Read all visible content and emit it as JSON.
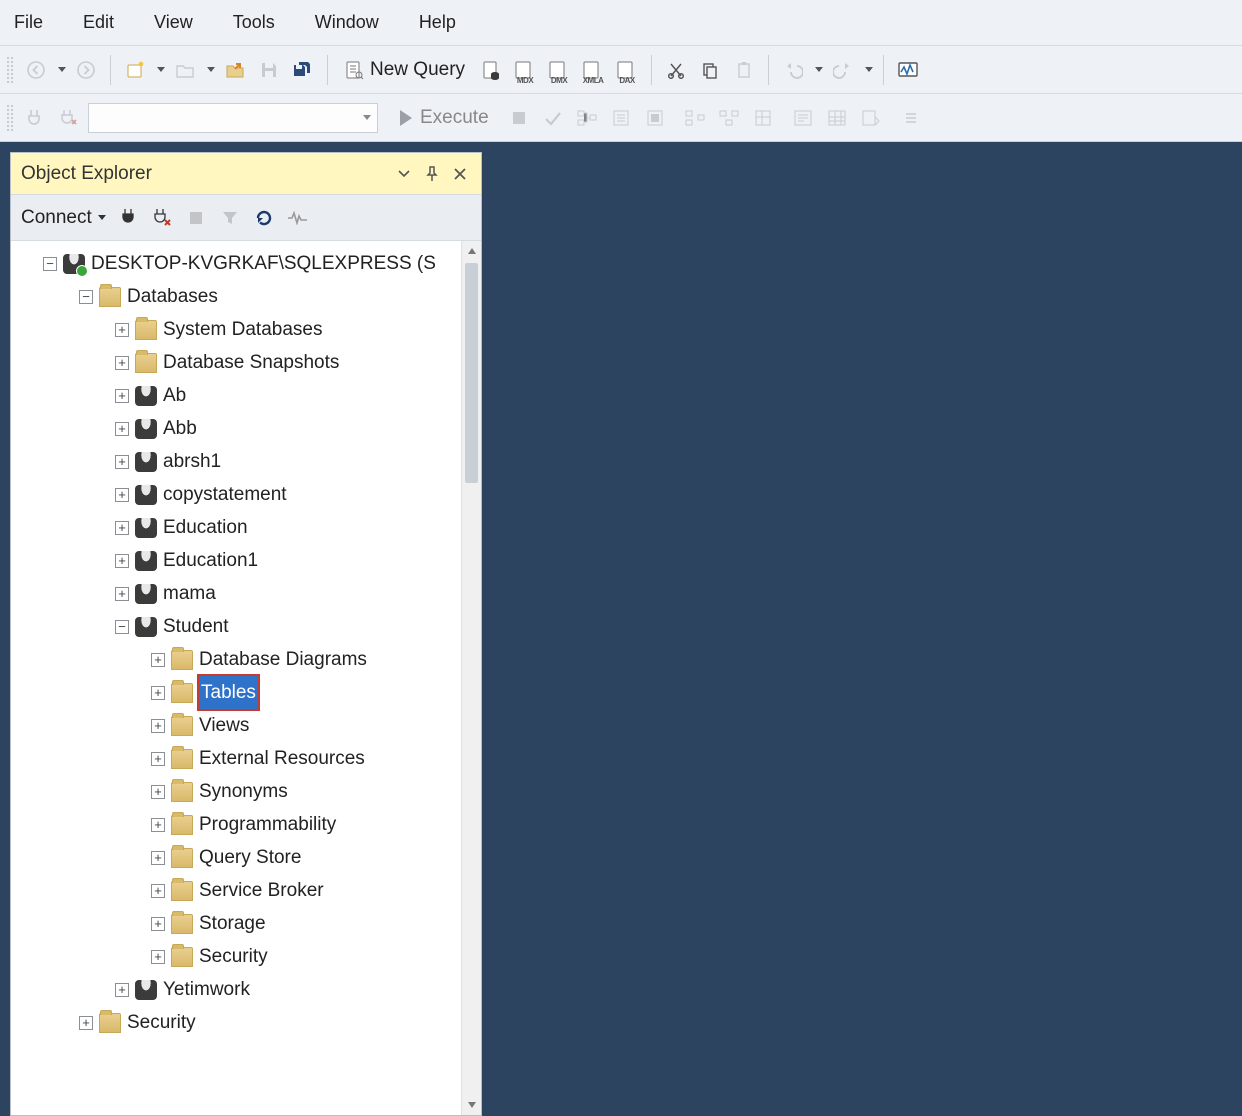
{
  "menu": {
    "file": "File",
    "edit": "Edit",
    "view": "View",
    "tools": "Tools",
    "window": "Window",
    "help": "Help"
  },
  "toolbar": {
    "new_query": "New Query",
    "mdx": "MDX",
    "dmx": "DMX",
    "xmla": "XMLA",
    "dax": "DAX"
  },
  "toolbar2": {
    "execute": "Execute"
  },
  "object_explorer": {
    "title": "Object Explorer",
    "connect": "Connect",
    "server": "DESKTOP-KVGRKAF\\SQLEXPRESS (S",
    "databases": "Databases",
    "children": {
      "system_databases": "System Databases",
      "database_snapshots": "Database Snapshots",
      "ab": "Ab",
      "abb": "Abb",
      "abrsh1": "abrsh1",
      "copystatement": "copystatement",
      "education": "Education",
      "education1": "Education1",
      "mama": "mama",
      "student": "Student",
      "yetimwork": "Yetimwork",
      "security": "Security"
    },
    "student_children": {
      "database_diagrams": "Database Diagrams",
      "tables": "Tables",
      "views": "Views",
      "external_resources": "External Resources",
      "synonyms": "Synonyms",
      "programmability": "Programmability",
      "query_store": "Query Store",
      "service_broker": "Service Broker",
      "storage": "Storage",
      "security": "Security"
    }
  }
}
